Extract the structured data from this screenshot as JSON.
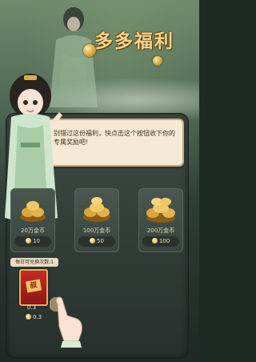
{
  "banner": {
    "title": "多多福利"
  },
  "dialog": {
    "text": "别错过这份福利，快点击这个按钮收下你的专属奖励吧!"
  },
  "rewards": [
    {
      "label": "20万金币",
      "price": "10"
    },
    {
      "label": "100万金币",
      "price": "50"
    },
    {
      "label": "200万金币",
      "price": "100"
    }
  ],
  "daily": {
    "limit_label": "每日可兑换次数:1",
    "packet_char": "叔",
    "value": "0.3",
    "coin_value": "0.3"
  },
  "colors": {
    "gold": "#f3d58a",
    "panel": "#3d4a44",
    "dialog_bg": "#f4ead4",
    "red_packet": "#c62a28"
  },
  "icons": [
    "coin-icon",
    "red-packet-icon",
    "pointing-hand-icon"
  ]
}
